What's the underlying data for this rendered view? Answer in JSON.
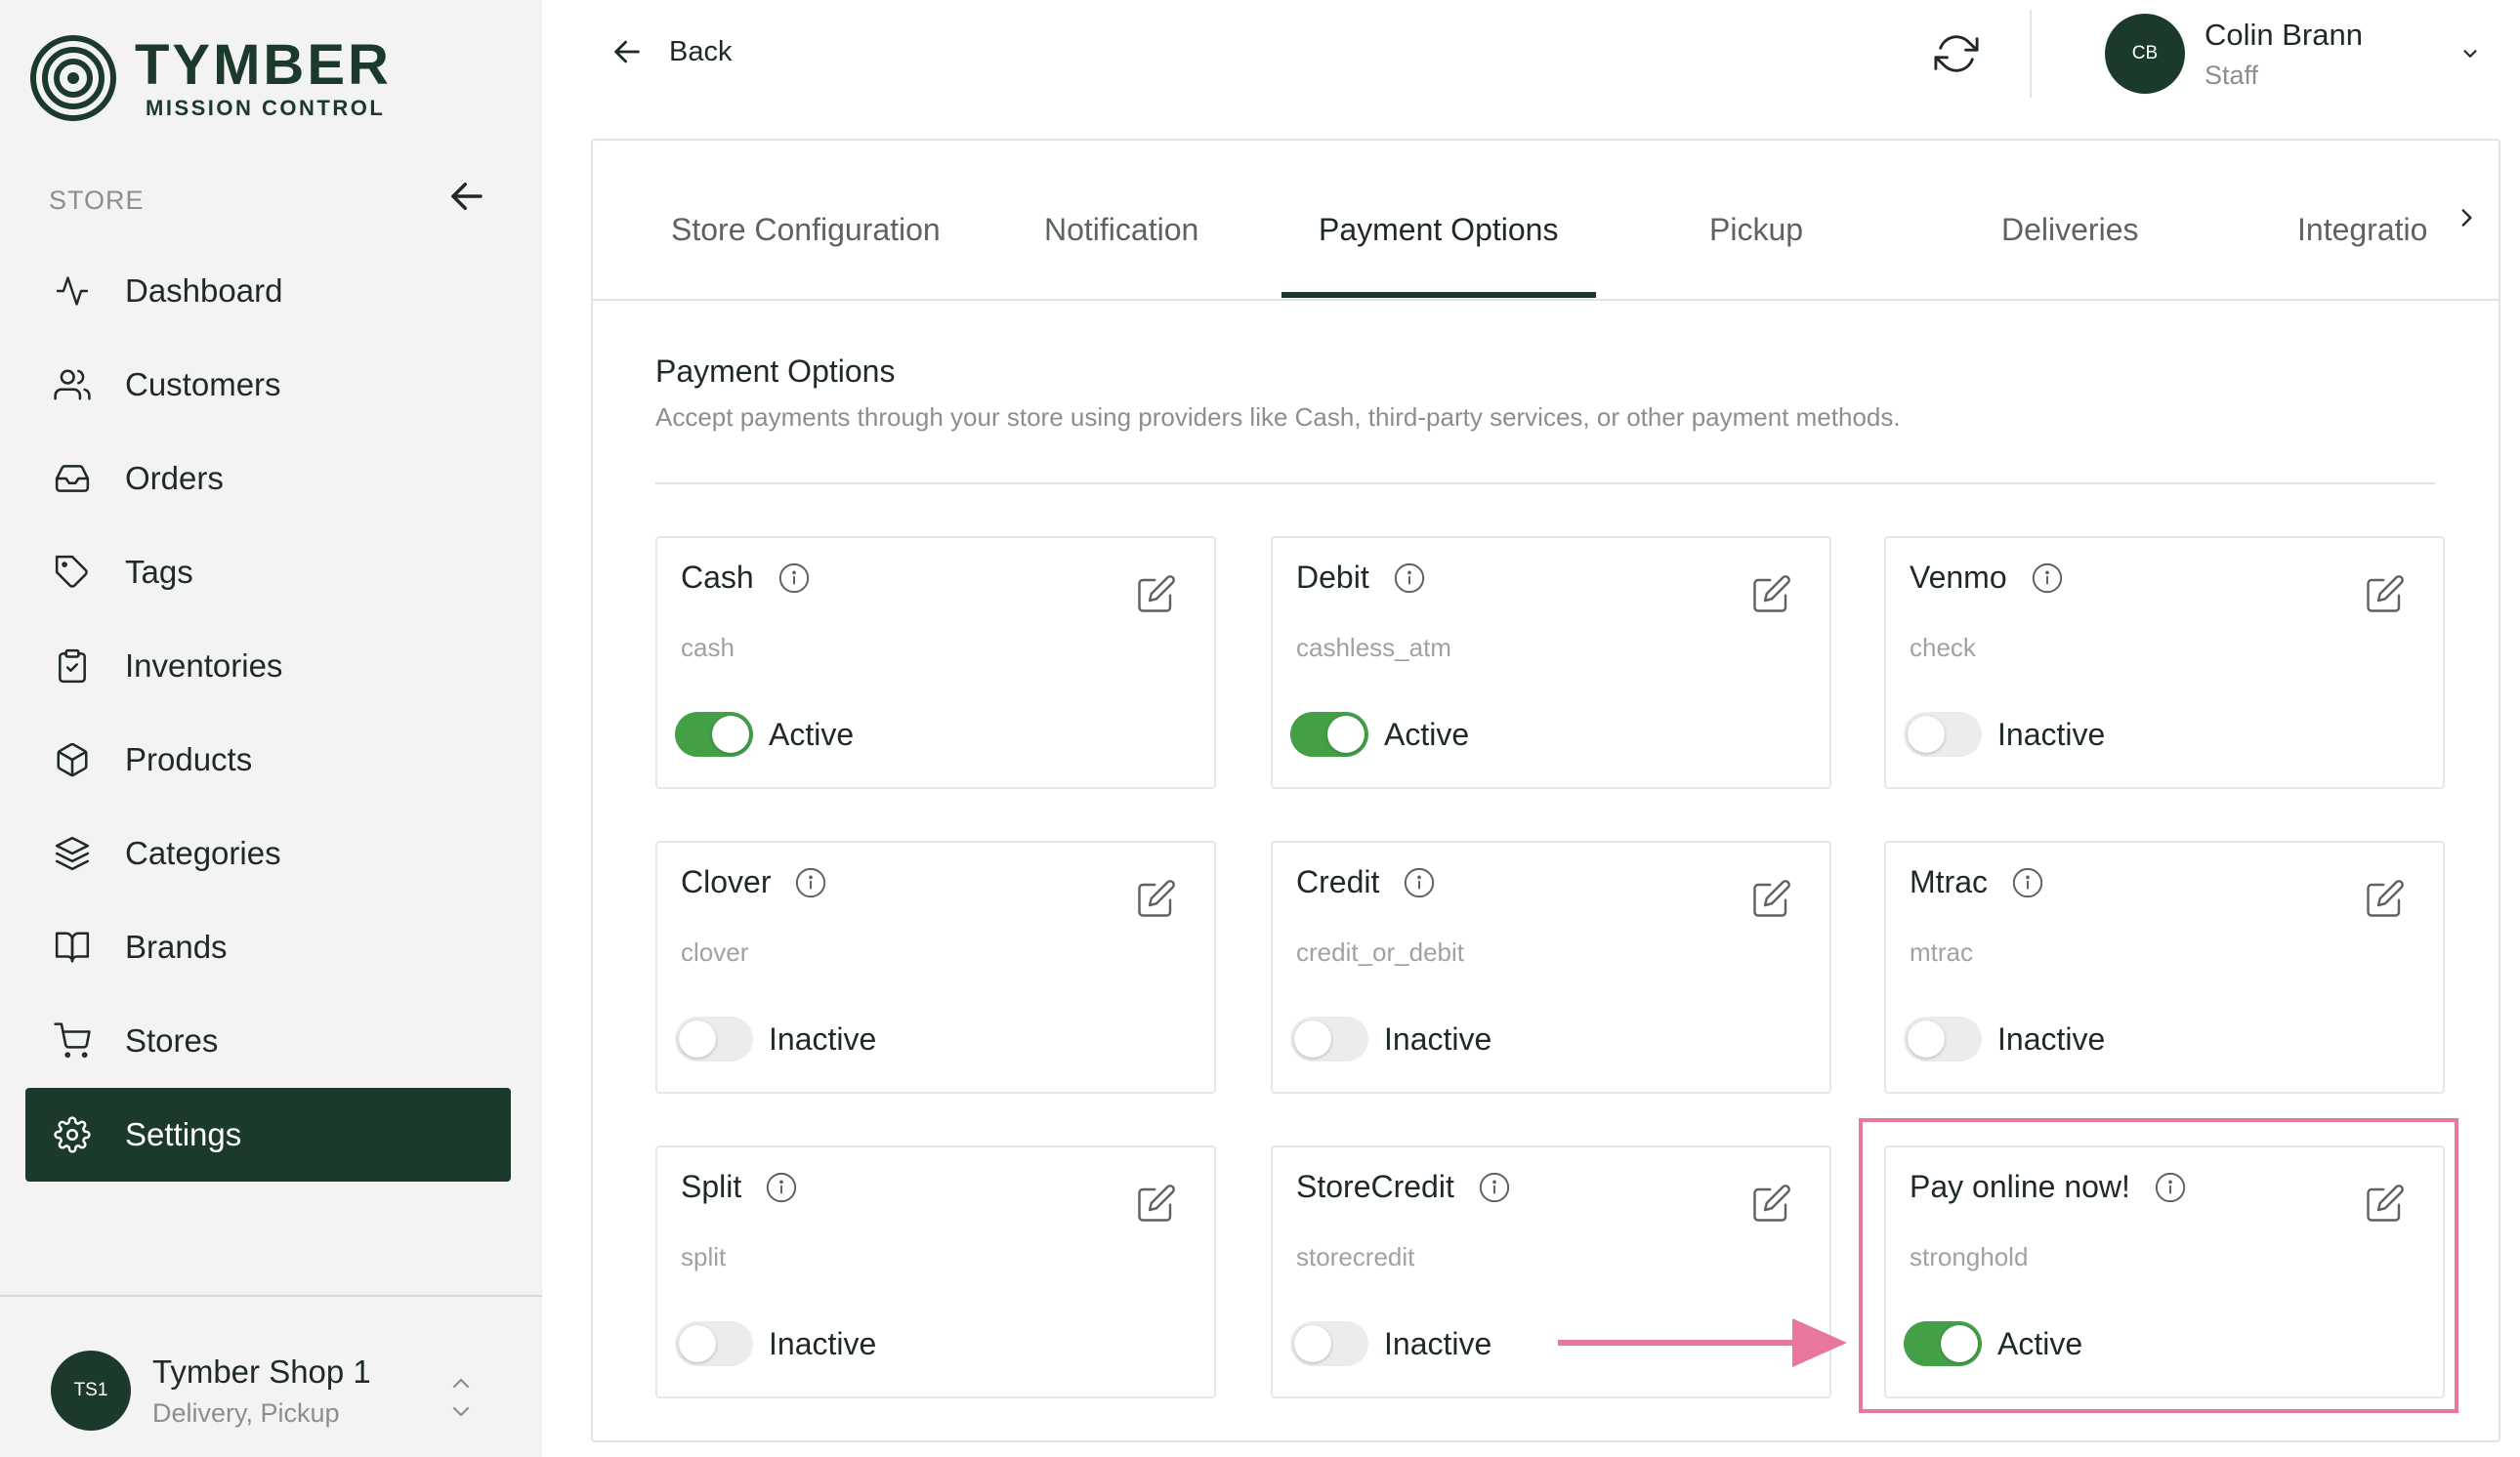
{
  "brand": {
    "name": "TYMBER",
    "subtitle": "MISSION CONTROL"
  },
  "sidebar": {
    "section_label": "STORE",
    "items": [
      {
        "label": "Dashboard",
        "icon": "activity-icon"
      },
      {
        "label": "Customers",
        "icon": "users-icon"
      },
      {
        "label": "Orders",
        "icon": "inbox-icon"
      },
      {
        "label": "Tags",
        "icon": "tag-icon"
      },
      {
        "label": "Inventories",
        "icon": "clipboard-check-icon"
      },
      {
        "label": "Products",
        "icon": "box-icon"
      },
      {
        "label": "Categories",
        "icon": "layers-icon"
      },
      {
        "label": "Brands",
        "icon": "book-open-icon"
      },
      {
        "label": "Stores",
        "icon": "cart-icon"
      },
      {
        "label": "Settings",
        "icon": "gear-icon",
        "active": true
      }
    ],
    "shop": {
      "initials": "TS1",
      "name": "Tymber Shop 1",
      "subtitle": "Delivery, Pickup"
    }
  },
  "header": {
    "back_label": "Back",
    "user": {
      "initials": "CB",
      "name": "Colin Brann",
      "role": "Staff"
    }
  },
  "tabs": [
    {
      "label": "Store Configuration"
    },
    {
      "label": "Notification"
    },
    {
      "label": "Payment Options",
      "active": true
    },
    {
      "label": "Pickup"
    },
    {
      "label": "Deliveries"
    },
    {
      "label": "Integratio"
    }
  ],
  "section": {
    "title": "Payment Options",
    "description": "Accept payments through your store using providers like Cash, third-party services, or other payment methods."
  },
  "payment_methods": [
    {
      "name": "Cash",
      "code": "cash",
      "status": "Active",
      "enabled": true
    },
    {
      "name": "Debit",
      "code": "cashless_atm",
      "status": "Active",
      "enabled": true
    },
    {
      "name": "Venmo",
      "code": "check",
      "status": "Inactive",
      "enabled": false
    },
    {
      "name": "Clover",
      "code": "clover",
      "status": "Inactive",
      "enabled": false
    },
    {
      "name": "Credit",
      "code": "credit_or_debit",
      "status": "Inactive",
      "enabled": false
    },
    {
      "name": "Mtrac",
      "code": "mtrac",
      "status": "Inactive",
      "enabled": false
    },
    {
      "name": "Split",
      "code": "split",
      "status": "Inactive",
      "enabled": false
    },
    {
      "name": "StoreCredit",
      "code": "storecredit",
      "status": "Inactive",
      "enabled": false
    },
    {
      "name": "Pay online now!",
      "code": "stronghold",
      "status": "Active",
      "enabled": true
    }
  ],
  "colors": {
    "brand_green": "#1b3a2c",
    "toggle_on": "#43a047",
    "highlight": "#e8769f"
  }
}
